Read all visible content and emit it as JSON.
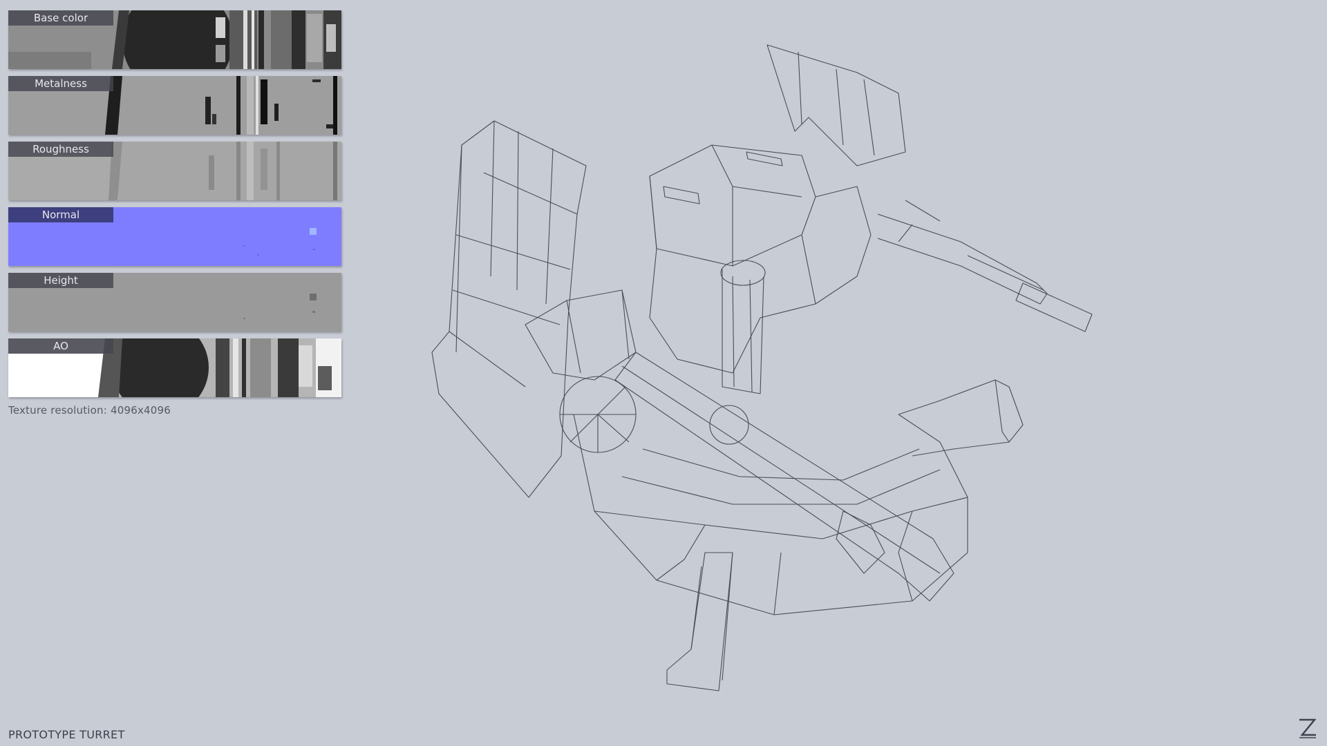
{
  "maps": [
    {
      "label": "Base color"
    },
    {
      "label": "Metalness"
    },
    {
      "label": "Roughness"
    },
    {
      "label": "Normal"
    },
    {
      "label": "Height"
    },
    {
      "label": "AO"
    }
  ],
  "texture_resolution": "Texture resolution: 4096x4096",
  "model_title": "PROTOTYPE TURRET",
  "colors": {
    "background": "#c8ccd5",
    "normal_map": "#7f7dff",
    "wire": "#4a4d56",
    "label_bg": "#4a4a54"
  },
  "icons": {
    "logo": "z-logo-icon"
  }
}
